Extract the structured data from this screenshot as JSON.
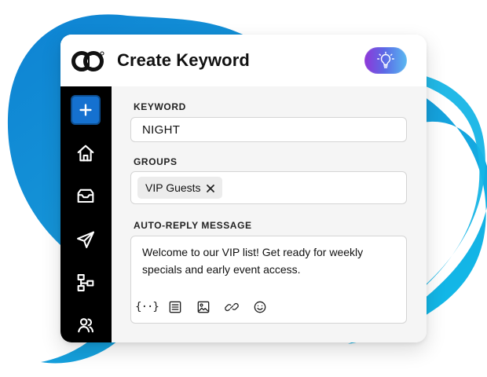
{
  "header": {
    "title": "Create Keyword",
    "logo_icon": "brand-logo-icon",
    "idea_icon": "lightbulb-icon"
  },
  "sidebar": {
    "items": [
      {
        "icon": "plus-icon"
      },
      {
        "icon": "home-icon"
      },
      {
        "icon": "inbox-icon"
      },
      {
        "icon": "send-icon"
      },
      {
        "icon": "flow-icon"
      },
      {
        "icon": "users-icon"
      }
    ]
  },
  "form": {
    "keyword_label": "KEYWORD",
    "keyword_value": "NIGHT",
    "groups_label": "GROUPS",
    "group_tag": "VIP Guests",
    "group_remove": "×",
    "reply_label": "AUTO-REPLY MESSAGE",
    "reply_message": "Welcome to our VIP list! Get ready for weekly specials and early event access.",
    "toolbar": {
      "variables_text": "{··}"
    }
  },
  "colors": {
    "accent_blue": "#1571d0",
    "sidebar_bg": "#000000",
    "main_bg": "#f5f5f5",
    "swirl_blue": "#19a8df",
    "idea_gradient_start": "#8f37d8",
    "idea_gradient_end": "#5ab8f1"
  }
}
